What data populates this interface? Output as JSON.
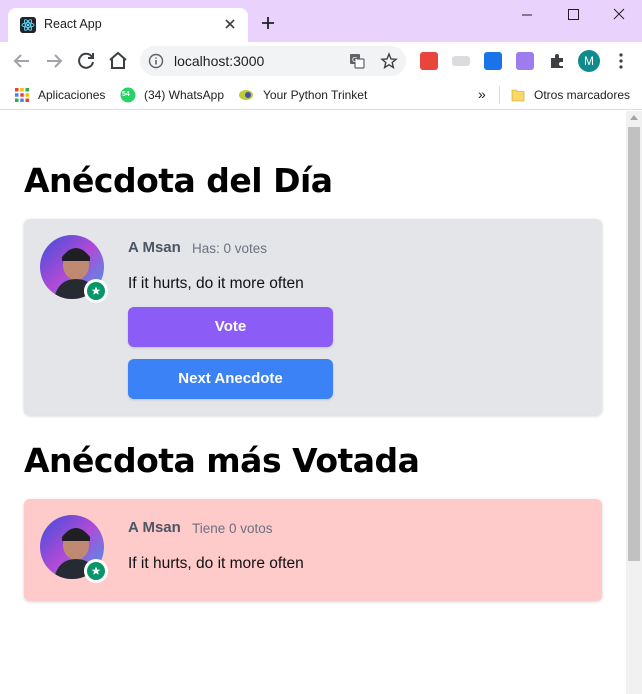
{
  "browser": {
    "tab_title": "React App",
    "url": "localhost:3000",
    "profile_initial": "M",
    "bookmarks": {
      "apps": "Aplicaciones",
      "whatsapp": "(34) WhatsApp",
      "whatsapp_badge": "54",
      "trinket": "Your Python Trinket",
      "overflow": "»",
      "others": "Otros marcadores"
    }
  },
  "page": {
    "daily": {
      "heading": "Anécdota del Día",
      "author": "A Msan",
      "votes_label": "Has: 0 votes",
      "text": "If it hurts, do it more often",
      "vote_button": "Vote",
      "next_button": "Next Anecdote"
    },
    "top": {
      "heading": "Anécdota más Votada",
      "author": "A Msan",
      "votes_label": "Tiene 0 votos",
      "text": "If it hurts, do it more often"
    }
  },
  "colors": {
    "titlebar": "#e9d2fb",
    "vote_button": "#8b5cf6",
    "next_button": "#3b82f6",
    "card_daily": "#e4e5e9",
    "card_top": "#fecaca",
    "badge": "#059669"
  }
}
